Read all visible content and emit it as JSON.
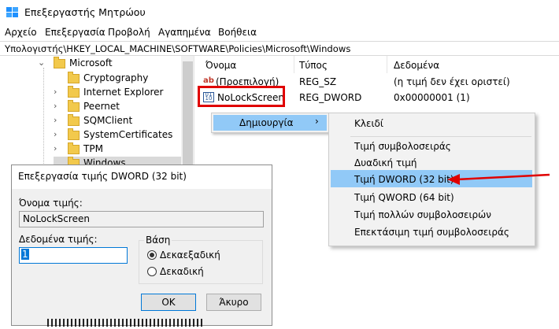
{
  "window": {
    "title": "Επεξεργαστής Μητρώου"
  },
  "menu": [
    "Αρχείο",
    "Επεξεργασία",
    "Προβολή",
    "Αγαπημένα",
    "Βοήθεια"
  ],
  "address": "Υπολογιστής\\HKEY_LOCAL_MACHINE\\SOFTWARE\\Policies\\Microsoft\\Windows",
  "tree": {
    "parent": "Microsoft",
    "children": [
      "Cryptography",
      "Internet Explorer",
      "Peernet",
      "SQMClient",
      "SystemCertificates",
      "TPM",
      "Windows"
    ]
  },
  "list": {
    "columns": [
      "Όνομα",
      "Τύπος",
      "Δεδομένα"
    ],
    "rows": [
      {
        "icon": "string-value-icon",
        "name": "(Προεπιλογή)",
        "type": "REG_SZ",
        "data": "(η τιμή δεν έχει οριστεί)"
      },
      {
        "icon": "dword-value-icon",
        "name": "NoLockScreen",
        "type": "REG_DWORD",
        "data": "0x00000001 (1)"
      }
    ]
  },
  "context_menu": {
    "item": "Δημιουργία",
    "submenu": [
      "Κλειδί",
      "Τιμή συμβολοσειράς",
      "Δυαδική τιμή",
      "Τιμή DWORD (32 bit)",
      "Τιμή QWORD (64 bit)",
      "Τιμή πολλών συμβολοσειρών",
      "Επεκτάσιμη τιμή συμβολοσειράς"
    ],
    "highlighted": "Τιμή DWORD (32 bit)"
  },
  "dialog": {
    "title": "Επεξεργασία τιμής DWORD (32 bit)",
    "value_name_label": "Όνομα τιμής:",
    "value_name": "NoLockScreen",
    "value_data_label": "Δεδομένα τιμής:",
    "value_data": "1",
    "base_label": "Βάση",
    "base_options": [
      "Δεκαεξαδική",
      "Δεκαδική"
    ],
    "base_selected": "Δεκαεξαδική",
    "ok": "OK",
    "cancel": "Άκυρο"
  },
  "colors": {
    "highlight": "#91c9f7",
    "annotation": "#e00000",
    "focus": "#0078d7"
  }
}
